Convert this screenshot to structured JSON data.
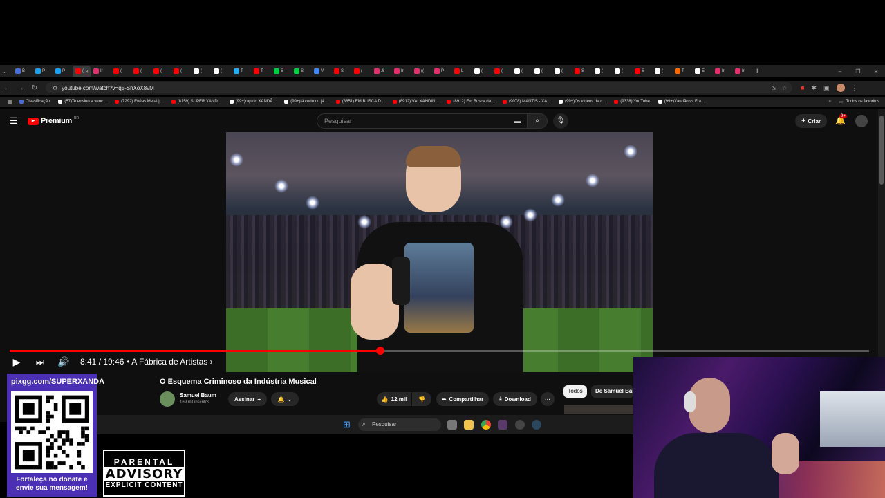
{
  "browser": {
    "tabs": [
      {
        "label": "B",
        "color": "#4a6fd8"
      },
      {
        "label": "P",
        "color": "#1da1f2"
      },
      {
        "label": "P",
        "color": "#1da1f2"
      },
      {
        "label": "(",
        "color": "#ff0000",
        "active": true
      },
      {
        "label": "Ir",
        "color": "#e1306c"
      },
      {
        "label": "(",
        "color": "#ff0000"
      },
      {
        "label": "(",
        "color": "#ff0000"
      },
      {
        "label": "(",
        "color": "#ff0000"
      },
      {
        "label": "(",
        "color": "#ff0000"
      },
      {
        "label": "(",
        "color": "#ffffff"
      },
      {
        "label": "(",
        "color": "#ffffff"
      },
      {
        "label": "T",
        "color": "#2aabee"
      },
      {
        "label": "T",
        "color": "#ff0000"
      },
      {
        "label": "S",
        "color": "#00cc44"
      },
      {
        "label": "S",
        "color": "#00cc44"
      },
      {
        "label": "V",
        "color": "#4285f4"
      },
      {
        "label": "S",
        "color": "#ff0000"
      },
      {
        "label": "(",
        "color": "#ff0000"
      },
      {
        "label": "Ji",
        "color": "#e1306c"
      },
      {
        "label": "Ir",
        "color": "#e1306c"
      },
      {
        "label": "((",
        "color": "#e1306c"
      },
      {
        "label": "P",
        "color": "#e1306c"
      },
      {
        "label": "L",
        "color": "#ff0000"
      },
      {
        "label": "(",
        "color": "#ffffff"
      },
      {
        "label": "(",
        "color": "#ff0000"
      },
      {
        "label": "(",
        "color": "#ffffff"
      },
      {
        "label": "(",
        "color": "#ffffff"
      },
      {
        "label": "(",
        "color": "#ffffff"
      },
      {
        "label": "S",
        "color": "#ff0000"
      },
      {
        "label": "(",
        "color": "#ffffff"
      },
      {
        "label": "(",
        "color": "#ffffff"
      },
      {
        "label": "S",
        "color": "#ff0000"
      },
      {
        "label": "(",
        "color": "#ffffff"
      },
      {
        "label": "T",
        "color": "#ff6a00"
      },
      {
        "label": "E",
        "color": "#ffffff"
      },
      {
        "label": "Ir",
        "color": "#e1306c"
      },
      {
        "label": "Ir",
        "color": "#e1306c"
      }
    ],
    "url": "youtube.com/watch?v=q5-SnXoX8vM",
    "bookmarks": [
      {
        "label": "Classificação",
        "color": "#4a6fd8"
      },
      {
        "label": "(57)Te ensino a venc...",
        "color": "#ffffff"
      },
      {
        "label": "(7292) Enéas Metal |...",
        "color": "#ff0000"
      },
      {
        "label": "(8159) SUPER XAND...",
        "color": "#ff0000"
      },
      {
        "label": "(99+)rap do XANDÃ...",
        "color": "#ffffff"
      },
      {
        "label": "(99+)tá cedo ou já...",
        "color": "#ffffff"
      },
      {
        "label": "(8851) EM BUSCA D...",
        "color": "#ff0000"
      },
      {
        "label": "(8912) VAI XANDIN...",
        "color": "#ff0000"
      },
      {
        "label": "(8912) Em Busca da...",
        "color": "#ff0000"
      },
      {
        "label": "(9078) MANTIS - XA...",
        "color": "#ff0000"
      },
      {
        "label": "(99+)Os vídeos de c...",
        "color": "#ffffff"
      },
      {
        "label": "(9338) YouTube",
        "color": "#ff0000"
      },
      {
        "label": "(99+)Xandão vs Fra...",
        "color": "#ffffff"
      }
    ],
    "all_bookmarks": "Todos os favoritos"
  },
  "youtube": {
    "logo": "Premium",
    "logo_region": "BR",
    "search_placeholder": "Pesquisar",
    "create_label": "Criar",
    "notif_count": "9+"
  },
  "player": {
    "progress_fraction": 0.431,
    "time": "8:41 / 19:46",
    "chapter": "• A Fábrica de Artistas",
    "chapter_arrow": "›"
  },
  "video": {
    "title": "O Esquema Criminoso da Indústria Musical",
    "channel": "Samuel Baum",
    "subs": "169 mil inscritos",
    "subscribe": "Assinar",
    "likes": "12 mil",
    "share": "Compartilhar",
    "download": "Download",
    "chips": [
      "Todos",
      "De Samuel Baum"
    ]
  },
  "taskbar": {
    "search": "Pesquisar"
  },
  "overlay": {
    "site": "pixgg.com/SUPERXANDA",
    "caption": "Fortaleça no donate e envie sua mensagem!",
    "advisory_top": "PARENTAL",
    "advisory_mid": "ADVISORY",
    "advisory_bot": "EXPLICIT CONTENT"
  },
  "colors": {
    "accent": "#ff0000",
    "qr_panel": "#4b2fb4"
  }
}
